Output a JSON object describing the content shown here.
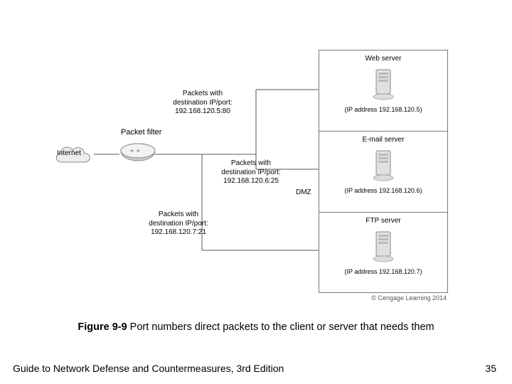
{
  "internet_label": "Internet",
  "packet_filter_label": "Packet filter",
  "dmz_label": "DMZ",
  "packets": {
    "web": {
      "line1": "Packets with",
      "line2": "destination IP/port:",
      "line3": "192.168.120.5:80"
    },
    "mail": {
      "line1": "Packets with",
      "line2": "destination IP/port:",
      "line3": "192.168.120.6:25"
    },
    "ftp": {
      "line1": "Packets with",
      "line2": "destination IP/port:",
      "line3": "192.168.120.7:21"
    }
  },
  "servers": {
    "web": {
      "title": "Web server",
      "ip": "(IP address 192.168.120.5)"
    },
    "mail": {
      "title": "E-mail server",
      "ip": "(IP address 192.168.120.6)"
    },
    "ftp": {
      "title": "FTP server",
      "ip": "(IP address 192.168.120.7)"
    }
  },
  "copyright": "© Cengage Learning 2014",
  "caption_bold": "Figure 9-9",
  "caption_rest": "  Port numbers direct packets to the client or server that needs them",
  "footer_left": "Guide to Network Defense and Countermeasures, 3rd Edition",
  "footer_right": "35"
}
